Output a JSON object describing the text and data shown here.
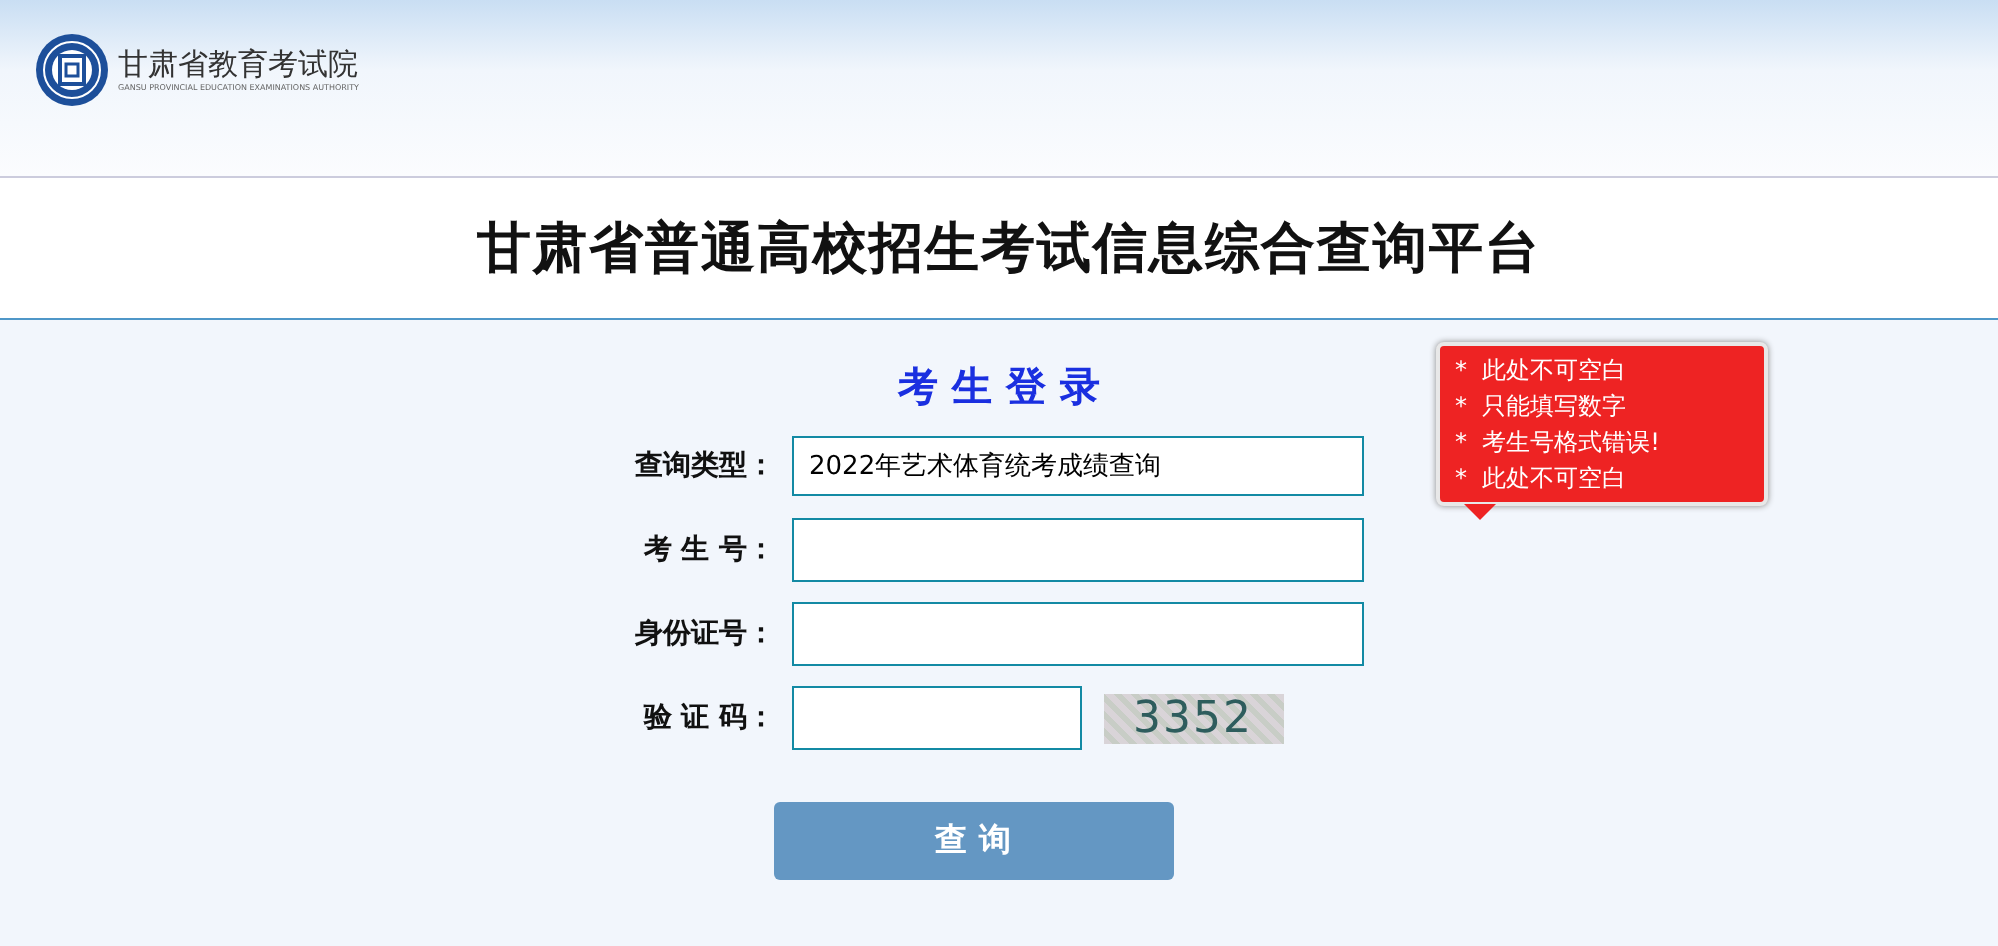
{
  "header": {
    "org_name": "甘肃省教育考试院",
    "org_subtitle": "GANSU PROVINCIAL EDUCATION EXAMINATIONS AUTHORITY"
  },
  "title": "甘肃省普通高校招生考试信息综合查询平台",
  "login": {
    "heading": "考 生 登 录",
    "fields": [
      {
        "kind": "select",
        "label": "查询类型：",
        "value": "2022年艺术体育统考成绩查询"
      },
      {
        "kind": "text",
        "label": "考 生 号："
      },
      {
        "kind": "text",
        "label": "身份证号："
      },
      {
        "kind": "captcha",
        "label": "验 证 码：",
        "captcha": "3352"
      }
    ],
    "tooltip": [
      "*  此处不可空白",
      "*  只能填写数字",
      "*  考生号格式错误!",
      "*  此处不可空白"
    ],
    "submit": "查 询"
  }
}
